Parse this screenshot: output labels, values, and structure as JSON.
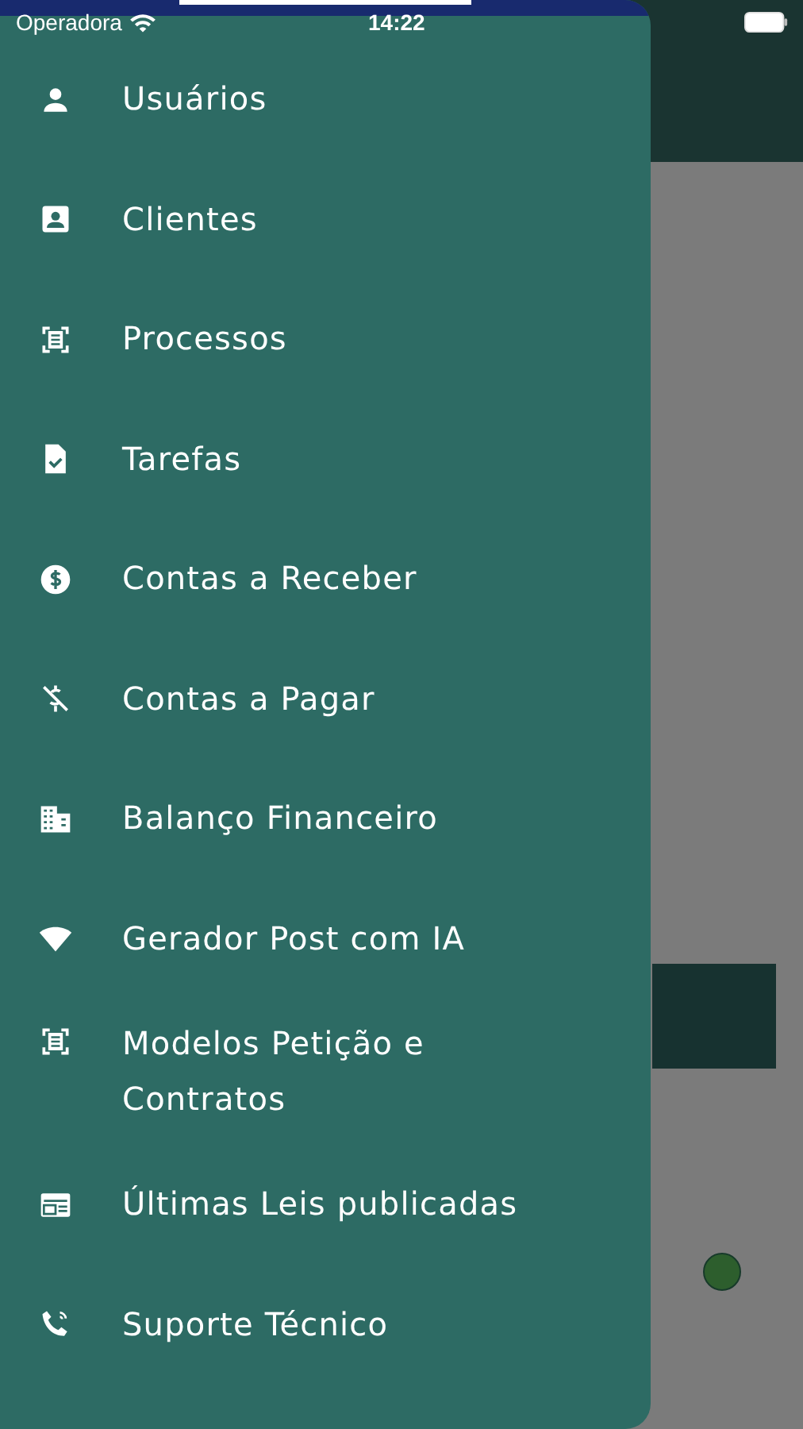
{
  "status_bar": {
    "carrier": "Operadora",
    "time": "14:22"
  },
  "drawer": {
    "items": [
      {
        "label": "Usuários",
        "kind": "person"
      },
      {
        "label": "Clientes",
        "kind": "contact"
      },
      {
        "label": "Processos",
        "kind": "document-scan"
      },
      {
        "label": "Tarefas",
        "kind": "task"
      },
      {
        "label": "Contas a Receber",
        "kind": "dollar"
      },
      {
        "label": "Contas a Pagar",
        "kind": "dollar-off"
      },
      {
        "label": "Balanço Financeiro",
        "kind": "building"
      },
      {
        "label": "Gerador Post com IA",
        "kind": "wifi"
      },
      {
        "label": "Modelos Petição e Contratos",
        "kind": "document-scan"
      },
      {
        "label": "Últimas Leis publicadas",
        "kind": "news"
      },
      {
        "label": "Suporte Técnico",
        "kind": "phone"
      }
    ]
  }
}
